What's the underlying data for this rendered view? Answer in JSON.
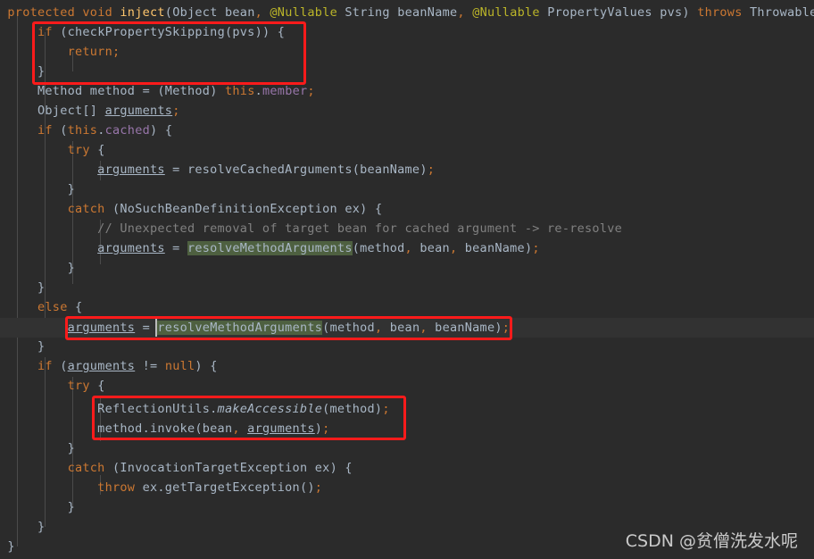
{
  "editor": {
    "theme_name": "darcula",
    "background": "#2b2b2b",
    "current_line_background": "#323232",
    "default_text_color": "#a9b7c6",
    "keyword_color": "#cc7832",
    "method_color": "#ffc66d",
    "annotation_color": "#bbb529",
    "field_color": "#9876aa",
    "comment_color": "#808080",
    "search_highlight_color": "#4e6040",
    "annotation_box_color": "#fb1b1b",
    "language": "java"
  },
  "code": {
    "lines": [
      "protected void inject(Object bean, @Nullable String beanName, @Nullable PropertyValues pvs) throws Throwable {",
      "    if (checkPropertySkipping(pvs)) {",
      "        return;",
      "    }",
      "    Method method = (Method) this.member;",
      "    Object[] arguments;",
      "    if (this.cached) {",
      "        try {",
      "            arguments = resolveCachedArguments(beanName);",
      "        }",
      "        catch (NoSuchBeanDefinitionException ex) {",
      "            // Unexpected removal of target bean for cached argument -> re-resolve",
      "            arguments = resolveMethodArguments(method, bean, beanName);",
      "        }",
      "    }",
      "    else {",
      "        arguments = resolveMethodArguments(method, bean, beanName);",
      "    }",
      "    if (arguments != null) {",
      "        try {",
      "            ReflectionUtils.makeAccessible(method);",
      "            method.invoke(bean, arguments);",
      "        }",
      "        catch (InvocationTargetException ex) {",
      "            throw ex.getTargetException();",
      "        }",
      "    }",
      "}"
    ]
  },
  "tokens": {
    "l0": {
      "protected": "protected",
      "void": "void",
      "inject": "inject",
      "object": "Object",
      "bean": "bean",
      "nullable1": "@Nullable",
      "string": "String",
      "beanName": "beanName",
      "nullable2": "@Nullable",
      "propertyValues": "PropertyValues",
      "pvs": "pvs",
      "throws": "throws",
      "throwable": "Throwable"
    },
    "l1": {
      "if": "if",
      "call": "checkPropertySkipping",
      "arg": "pvs"
    },
    "l2": {
      "return": "return"
    },
    "l4": {
      "type": "Method",
      "var": "method",
      "cast": "(Method)",
      "this": "this",
      "field": "member"
    },
    "l5": {
      "type": "Object[]",
      "var": "arguments"
    },
    "l6": {
      "if": "if",
      "this": "this",
      "field": "cached"
    },
    "l7": {
      "try": "try"
    },
    "l8": {
      "var": "arguments",
      "call": "resolveCachedArguments",
      "arg": "beanName"
    },
    "l10": {
      "catch": "catch",
      "exc": "NoSuchBeanDefinitionException",
      "var": "ex"
    },
    "l11": {
      "comment": "// Unexpected removal of target bean for cached argument -> re-resolve"
    },
    "l12": {
      "var": "arguments",
      "call": "resolveMethodArguments",
      "a1": "method",
      "a2": "bean",
      "a3": "beanName"
    },
    "l15": {
      "else": "else"
    },
    "l16": {
      "var": "arguments",
      "call": "resolveMethodArguments",
      "a1": "method",
      "a2": "bean",
      "a3": "beanName"
    },
    "l18": {
      "if": "if",
      "var": "arguments",
      "op": "!=",
      "null": "null"
    },
    "l19": {
      "try": "try"
    },
    "l20": {
      "cls": "ReflectionUtils",
      "mth": "makeAccessible",
      "arg": "method"
    },
    "l21": {
      "obj": "method",
      "mth": "invoke",
      "a1": "bean",
      "a2": "arguments"
    },
    "l23": {
      "catch": "catch",
      "exc": "InvocationTargetException",
      "var": "ex"
    },
    "l24": {
      "throw": "throw",
      "obj": "ex",
      "mth": "getTargetException"
    }
  },
  "annotations": {
    "boxes": [
      {
        "label": "highlight-box-skip-check",
        "note": "if (checkPropertySkipping(pvs)) { return; }"
      },
      {
        "label": "highlight-box-resolve-method-arguments",
        "note": "arguments = resolveMethodArguments(method, bean, beanName);"
      },
      {
        "label": "highlight-box-reflection-invoke",
        "note": "ReflectionUtils.makeAccessible(method); method.invoke(bean, arguments);"
      }
    ],
    "search_match": "resolveMethodArguments"
  },
  "watermark": {
    "text": "CSDN @贫僧洗发水呢"
  }
}
